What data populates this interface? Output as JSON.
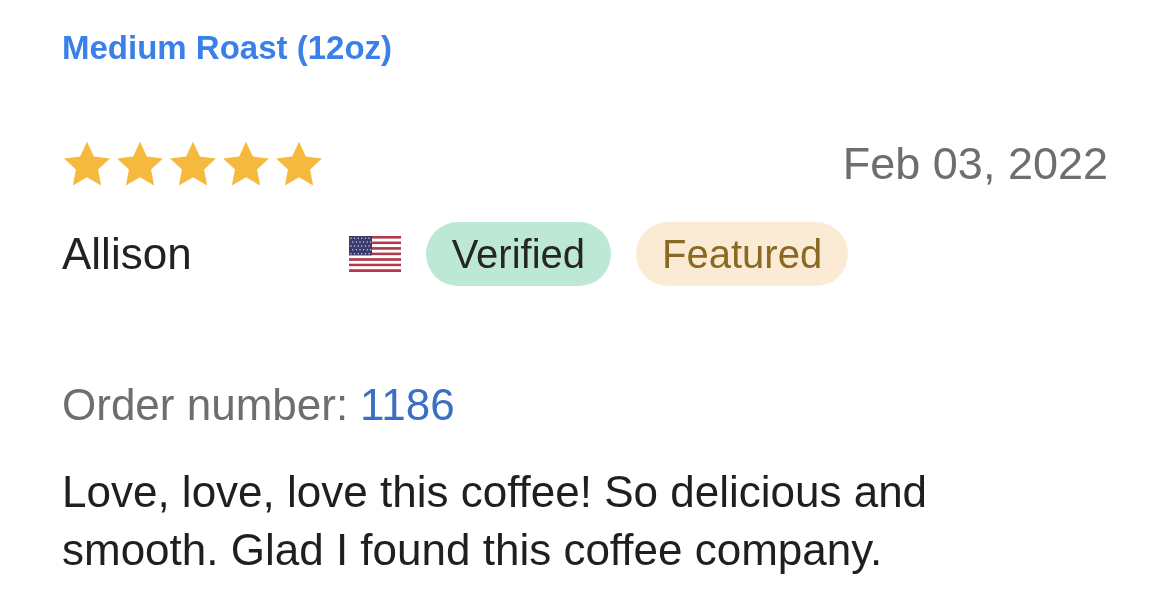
{
  "product_link": "Medium Roast (12oz)",
  "review": {
    "stars": 5,
    "date": "Feb 03, 2022",
    "author": "Allison",
    "badges": [
      {
        "kind": "verified",
        "label": "Verified"
      },
      {
        "kind": "featured",
        "label": "Featured"
      }
    ],
    "order_label": "Order number:",
    "order_number": "1186",
    "text": "Love, love, love this coffee! So delicious and smooth. Glad I found this coffee company."
  }
}
